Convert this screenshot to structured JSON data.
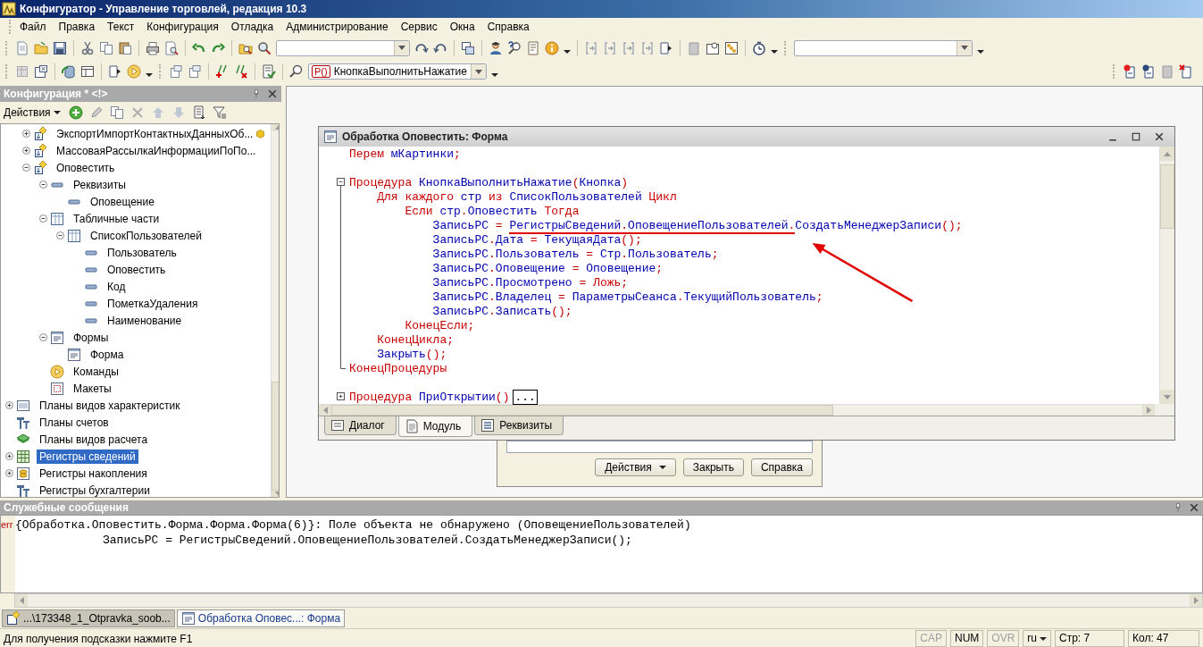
{
  "window": {
    "title": "Конфигуратор - Управление торговлей, редакция 10.3"
  },
  "menu": [
    "Файл",
    "Правка",
    "Текст",
    "Конфигурация",
    "Отладка",
    "Администрирование",
    "Сервис",
    "Окна",
    "Справка"
  ],
  "toolbar": {
    "procedure_combo": {
      "icon_text": "P()",
      "value": "КнопкаВыполнитьНажатие"
    }
  },
  "config_panel": {
    "title": "Конфигурация * <!>",
    "actions_label": "Действия",
    "tree": {
      "continued_children": [
        {
          "label": "ЭкспортИмпортКонтактныхДанныхОб...",
          "kind": "processing",
          "expanded": false,
          "selected": false,
          "support_mark": true
        },
        {
          "label": "МассоваяРассылкаИнформацииПоПо...",
          "kind": "processing",
          "expanded": false,
          "selected": false
        },
        {
          "label": "Оповестить",
          "kind": "processing",
          "expanded": true,
          "selected": false,
          "children": [
            {
              "label": "Реквизиты",
              "kind": "attribute",
              "expanded": true,
              "selected": false,
              "children": [
                {
                  "label": "Оповещение",
                  "kind": "attribute",
                  "selected": false
                }
              ]
            },
            {
              "label": "Табличные части",
              "kind": "tabular",
              "expanded": true,
              "selected": false,
              "children": [
                {
                  "label": "СписокПользователей",
                  "kind": "tabular",
                  "expanded": true,
                  "selected": false,
                  "children": [
                    {
                      "label": "Пользователь",
                      "kind": "attribute",
                      "selected": false
                    },
                    {
                      "label": "Оповестить",
                      "kind": "attribute",
                      "selected": false
                    },
                    {
                      "label": "Код",
                      "kind": "attribute",
                      "selected": false
                    },
                    {
                      "label": "ПометкаУдаления",
                      "kind": "attribute",
                      "selected": false
                    },
                    {
                      "label": "Наименование",
                      "kind": "attribute",
                      "selected": false
                    }
                  ]
                }
              ]
            },
            {
              "label": "Формы",
              "kind": "form",
              "expanded": true,
              "selected": false,
              "children": [
                {
                  "label": "Форма",
                  "kind": "form",
                  "selected": false
                }
              ]
            },
            {
              "label": "Команды",
              "kind": "command",
              "selected": false
            },
            {
              "label": "Макеты",
              "kind": "template",
              "selected": false
            }
          ]
        }
      ],
      "items": [
        {
          "label": "Планы видов характеристик",
          "kind": "characteristics",
          "expanded": false,
          "selected": false
        },
        {
          "label": "Планы счетов",
          "kind": "accounts",
          "selected": false
        },
        {
          "label": "Планы видов расчета",
          "kind": "calculation",
          "selected": false
        },
        {
          "label": "Регистры сведений",
          "kind": "info-register",
          "expanded": false,
          "selected": true
        },
        {
          "label": "Регистры накопления",
          "kind": "accumulation-register",
          "expanded": false,
          "selected": false
        },
        {
          "label": "Регистры бухгалтерии",
          "kind": "accounts",
          "selected": false
        }
      ]
    }
  },
  "editor": {
    "title": "Обработка Оповестить: Форма",
    "lines": [
      {
        "kind": "code",
        "tokens": [
          {
            "text": "Перем ",
            "kind": "keyword"
          },
          {
            "text": "мКартинки",
            "kind": "name"
          },
          {
            "text": ";",
            "kind": "keyword"
          }
        ]
      },
      {
        "kind": "blank"
      },
      {
        "kind": "fold-start",
        "tokens": [
          {
            "text": "Процедура ",
            "kind": "keyword"
          },
          {
            "text": "КнопкаВыполнитьНажатие",
            "kind": "name"
          },
          {
            "text": "(",
            "kind": "keyword"
          },
          {
            "text": "Кнопка",
            "kind": "name"
          },
          {
            "text": ")",
            "kind": "keyword"
          }
        ]
      },
      {
        "kind": "code",
        "tokens": [
          {
            "text": "    Для каждого ",
            "kind": "keyword"
          },
          {
            "text": "стр",
            "kind": "name"
          },
          {
            "text": " из ",
            "kind": "keyword"
          },
          {
            "text": "СписокПользователей",
            "kind": "name"
          },
          {
            "text": " Цикл",
            "kind": "keyword"
          }
        ]
      },
      {
        "kind": "code",
        "tokens": [
          {
            "text": "        Если ",
            "kind": "keyword"
          },
          {
            "text": "стр",
            "kind": "name"
          },
          {
            "text": ".",
            "kind": "keyword"
          },
          {
            "text": "Оповестить",
            "kind": "name"
          },
          {
            "text": " Тогда",
            "kind": "keyword"
          }
        ]
      },
      {
        "kind": "code",
        "tokens": [
          {
            "text": "            ЗаписьРС",
            "kind": "name"
          },
          {
            "text": " = ",
            "kind": "keyword"
          },
          {
            "text": "РегистрыСведений",
            "kind": "marked-name"
          },
          {
            "text": ".",
            "kind": "marked-keyword"
          },
          {
            "text": "ОповещениеПользователей",
            "kind": "marked-name"
          },
          {
            "text": ".",
            "kind": "marked-keyword"
          },
          {
            "text": "СоздатьМенеджерЗаписи",
            "kind": "name"
          },
          {
            "text": "();",
            "kind": "keyword"
          }
        ]
      },
      {
        "kind": "code",
        "tokens": [
          {
            "text": "            ЗаписьРС",
            "kind": "name"
          },
          {
            "text": ".",
            "kind": "keyword"
          },
          {
            "text": "Дата",
            "kind": "name"
          },
          {
            "text": " = ",
            "kind": "keyword"
          },
          {
            "text": "ТекущаяДата",
            "kind": "name"
          },
          {
            "text": "();",
            "kind": "keyword"
          }
        ]
      },
      {
        "kind": "code",
        "tokens": [
          {
            "text": "            ЗаписьРС",
            "kind": "name"
          },
          {
            "text": ".",
            "kind": "keyword"
          },
          {
            "text": "Пользователь",
            "kind": "name"
          },
          {
            "text": " = ",
            "kind": "keyword"
          },
          {
            "text": "Стр",
            "kind": "name"
          },
          {
            "text": ".",
            "kind": "keyword"
          },
          {
            "text": "Пользователь",
            "kind": "name"
          },
          {
            "text": ";",
            "kind": "keyword"
          }
        ]
      },
      {
        "kind": "code",
        "tokens": [
          {
            "text": "            ЗаписьРС",
            "kind": "name"
          },
          {
            "text": ".",
            "kind": "keyword"
          },
          {
            "text": "Оповещение",
            "kind": "name"
          },
          {
            "text": " = ",
            "kind": "keyword"
          },
          {
            "text": "Оповещение",
            "kind": "name"
          },
          {
            "text": ";",
            "kind": "keyword"
          }
        ]
      },
      {
        "kind": "code",
        "tokens": [
          {
            "text": "            ЗаписьРС",
            "kind": "name"
          },
          {
            "text": ".",
            "kind": "keyword"
          },
          {
            "text": "Просмотрено",
            "kind": "name"
          },
          {
            "text": " = Ложь;",
            "kind": "keyword"
          }
        ]
      },
      {
        "kind": "code",
        "tokens": [
          {
            "text": "            ЗаписьРС",
            "kind": "name"
          },
          {
            "text": ".",
            "kind": "keyword"
          },
          {
            "text": "Владелец",
            "kind": "name"
          },
          {
            "text": " = ",
            "kind": "keyword"
          },
          {
            "text": "ПараметрыСеанса",
            "kind": "name"
          },
          {
            "text": ".",
            "kind": "keyword"
          },
          {
            "text": "ТекущийПользователь",
            "kind": "name"
          },
          {
            "text": ";",
            "kind": "keyword"
          }
        ]
      },
      {
        "kind": "code",
        "tokens": [
          {
            "text": "            ЗаписьРС",
            "kind": "name"
          },
          {
            "text": ".",
            "kind": "keyword"
          },
          {
            "text": "Записать",
            "kind": "name"
          },
          {
            "text": "();",
            "kind": "keyword"
          }
        ]
      },
      {
        "kind": "code",
        "tokens": [
          {
            "text": "        КонецЕсли;",
            "kind": "keyword"
          }
        ]
      },
      {
        "kind": "code",
        "tokens": [
          {
            "text": "    КонецЦикла;",
            "kind": "keyword"
          }
        ]
      },
      {
        "kind": "code",
        "tokens": [
          {
            "text": "    Закрыть",
            "kind": "name"
          },
          {
            "text": "();",
            "kind": "keyword"
          }
        ]
      },
      {
        "kind": "fold-end",
        "tokens": [
          {
            "text": "КонецПроцедуры",
            "kind": "keyword"
          }
        ]
      },
      {
        "kind": "blank"
      },
      {
        "kind": "folded",
        "tokens": [
          {
            "text": "Процедура ",
            "kind": "keyword"
          },
          {
            "text": "ПриОткрытии",
            "kind": "name"
          },
          {
            "text": "()",
            "kind": "keyword"
          },
          {
            "text": "...",
            "kind": "collapsed"
          }
        ]
      }
    ],
    "tabs": [
      {
        "label": "Диалог",
        "kind": "dialog",
        "selected": false
      },
      {
        "label": "Модуль",
        "kind": "module",
        "selected": true
      },
      {
        "label": "Реквизиты",
        "kind": "attributes",
        "selected": false
      }
    ]
  },
  "background_form": {
    "buttons": [
      {
        "label": "Действия",
        "kind": "menu"
      },
      {
        "label": "Закрыть",
        "kind": "plain"
      },
      {
        "label": "Справка",
        "kind": "plain"
      }
    ]
  },
  "messages": {
    "title": "Служебные сообщения",
    "items": [
      {
        "marker": "err",
        "text": "{Обработка.Оповестить.Форма.Форма.Форма(6)}: Поле объекта не обнаружено (ОповещениеПользователей)",
        "detail": "ЗаписьРС = РегистрыСведений.ОповещениеПользователей.СоздатьМенеджерЗаписи();"
      }
    ]
  },
  "window_tabs": [
    {
      "label": "...\\173348_1_Otpravka_soob...",
      "kind": "configuration",
      "selected": false
    },
    {
      "label": "Обработка Оповес...: Форма",
      "kind": "form",
      "selected": true
    }
  ],
  "status_bar": {
    "hint": "Для получения подсказки нажмите F1",
    "indicators": [
      {
        "label": "CAP",
        "on": false
      },
      {
        "label": "NUM",
        "on": true
      },
      {
        "label": "OVR",
        "on": false
      }
    ],
    "language": "ru",
    "line": "Стр: 7",
    "column": "Кол: 47"
  }
}
